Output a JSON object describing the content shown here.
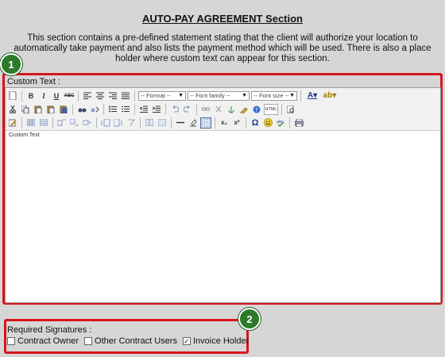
{
  "header": {
    "title": "AUTO-PAY AGREEMENT Section",
    "description": "This section contains a pre-defined statement stating that the client will authorize your location to automatically take payment and also lists the payment method which will be used. There is also a place holder where custom text can appear for this section."
  },
  "custom_text": {
    "label": "Custom Text :",
    "content": "Custom Text",
    "toolbar": {
      "format_select": "-- Format --",
      "font_family_select": "-- Font family --",
      "font_size_select": "-- Font size --",
      "bold": "B",
      "italic": "I",
      "underline": "U",
      "strike": "ABC",
      "subscript": "x₂",
      "superscript": "x²",
      "omega": "Ω",
      "html": "HTML"
    }
  },
  "signatures": {
    "label": "Required Signatures :",
    "options": [
      {
        "label": "Contract Owner",
        "checked": false
      },
      {
        "label": "Other Contract Users",
        "checked": false
      },
      {
        "label": "Invoice Holder",
        "checked": true
      }
    ]
  },
  "callouts": {
    "one": "1",
    "two": "2"
  },
  "colors": {
    "callout_border": "#d7141b",
    "callout_badge": "#2c7a2a",
    "page_bg": "#d6d6d6"
  }
}
